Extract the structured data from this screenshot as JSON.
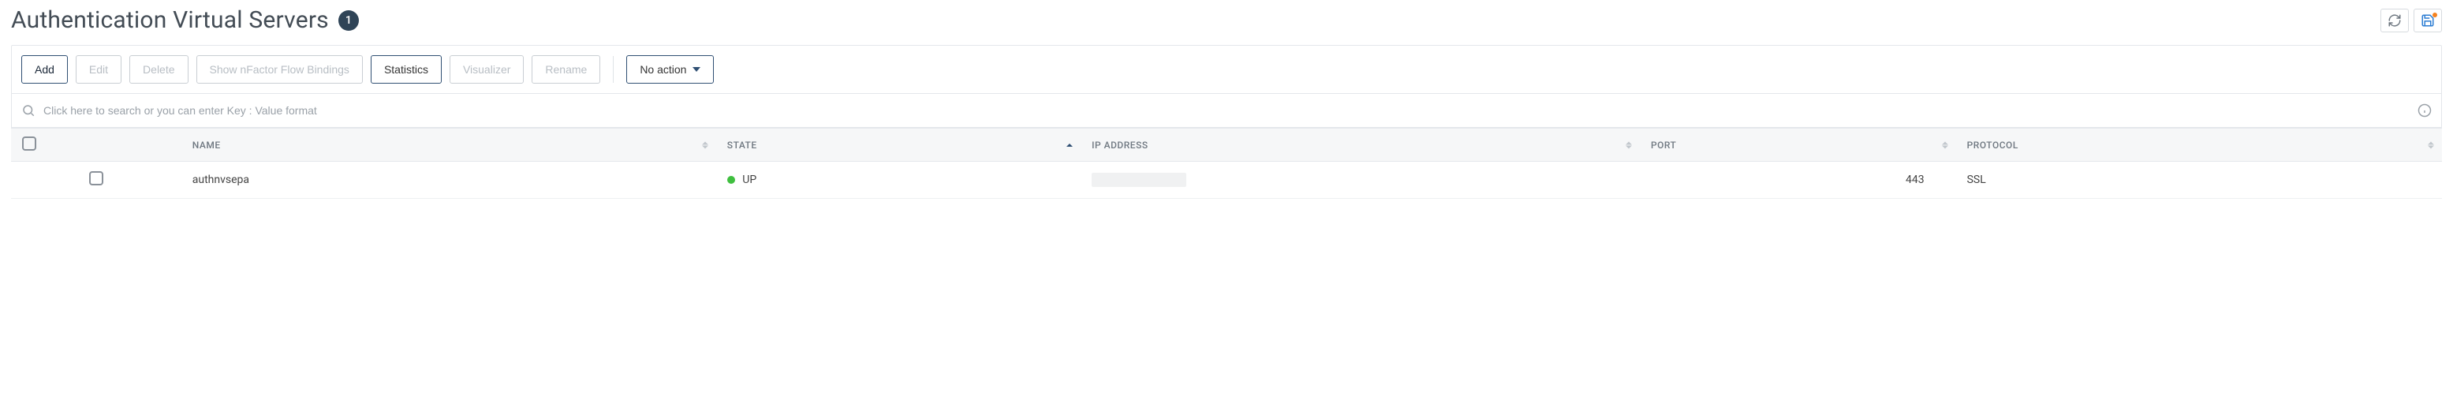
{
  "header": {
    "title": "Authentication Virtual Servers",
    "count": "1"
  },
  "toolbar": {
    "add": "Add",
    "edit": "Edit",
    "delete": "Delete",
    "show_bindings": "Show nFactor Flow Bindings",
    "statistics": "Statistics",
    "visualizer": "Visualizer",
    "rename": "Rename",
    "no_action": "No action"
  },
  "search": {
    "placeholder": "Click here to search or you can enter Key : Value format"
  },
  "columns": {
    "name": "NAME",
    "state": "STATE",
    "ip": "IP ADDRESS",
    "port": "PORT",
    "protocol": "PROTOCOL"
  },
  "rows": [
    {
      "name": "authnvsepa",
      "state": "UP",
      "state_color": "up",
      "ip": "",
      "port": "443",
      "protocol": "SSL"
    }
  ]
}
